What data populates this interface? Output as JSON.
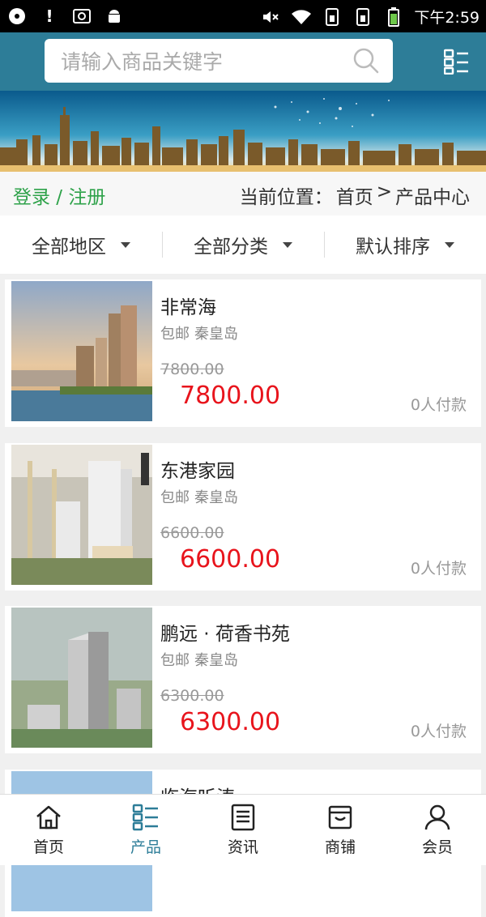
{
  "status_bar": {
    "time": "下午2:59",
    "left_icons": [
      "cd-icon",
      "exclamation-icon",
      "screenshot-icon",
      "android-icon"
    ],
    "right_icons": [
      "mute-icon",
      "wifi-icon",
      "sim1-icon",
      "sim2-icon",
      "battery-icon"
    ]
  },
  "search": {
    "placeholder": "请输入商品关键字"
  },
  "breadcrumb": {
    "login_text": "登录 / 注册",
    "prefix": "当前位置：",
    "home": "首页",
    "separator": ">",
    "current": "产品中心"
  },
  "filters": [
    {
      "label": "全部地区"
    },
    {
      "label": "全部分类"
    },
    {
      "label": "默认排序"
    }
  ],
  "products": [
    {
      "name": "非常海",
      "shipping": "包邮",
      "city": "秦皇岛",
      "old_price": "7800.00",
      "price": "7800.00",
      "sold": "0人付款"
    },
    {
      "name": "东港家园",
      "shipping": "包邮",
      "city": "秦皇岛",
      "old_price": "6600.00",
      "price": "6600.00",
      "sold": "0人付款"
    },
    {
      "name": "鹏远 · 荷香书苑",
      "shipping": "包邮",
      "city": "秦皇岛",
      "old_price": "6300.00",
      "price": "6300.00",
      "sold": "0人付款"
    },
    {
      "name": "临海听涛"
    }
  ],
  "tabbar": [
    {
      "label": "首页",
      "icon": "home-icon"
    },
    {
      "label": "产品",
      "icon": "products-icon",
      "active": true
    },
    {
      "label": "资讯",
      "icon": "news-icon"
    },
    {
      "label": "商铺",
      "icon": "shop-icon"
    },
    {
      "label": "会员",
      "icon": "user-icon"
    }
  ],
  "colors": {
    "header": "#2d7d98",
    "login": "#2ea24a",
    "price": "#e8141c",
    "active_tab": "#2d7d98"
  }
}
